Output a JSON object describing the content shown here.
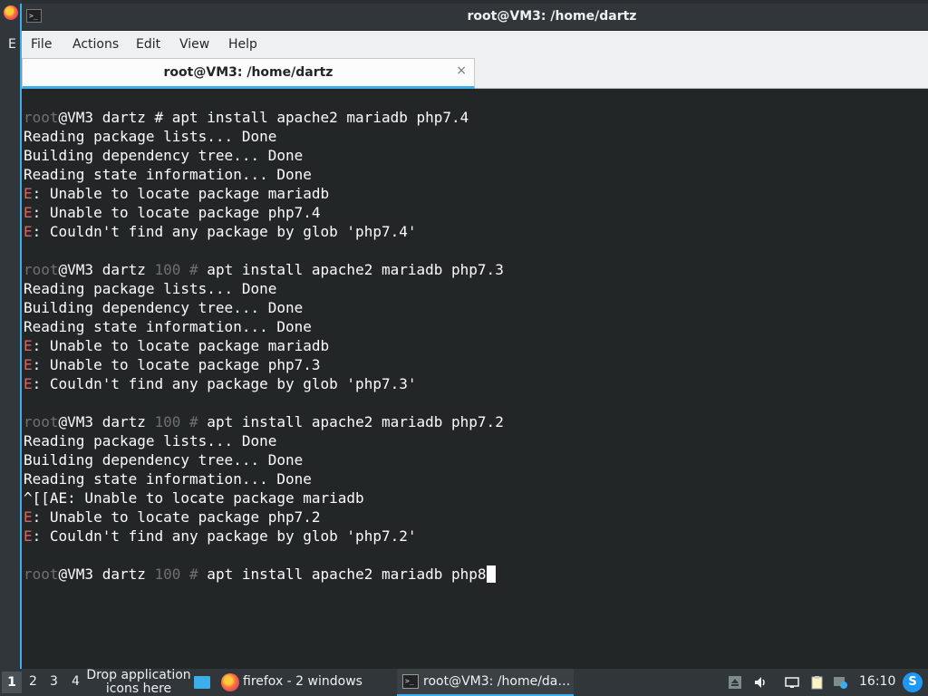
{
  "window": {
    "title": "root@VM3: /home/dartz",
    "menu": [
      "File",
      "Actions",
      "Edit",
      "View",
      "Help"
    ],
    "tab_title": "root@VM3: /home/dartz",
    "tab_close": "×"
  },
  "terminal": {
    "lines": [
      [
        {
          "t": "root",
          "c": "dim"
        },
        {
          "t": "@VM3 dartz # apt install apache2 mariadb php7.4"
        }
      ],
      [
        {
          "t": "Reading package lists... Done"
        }
      ],
      [
        {
          "t": "Building dependency tree... Done"
        }
      ],
      [
        {
          "t": "Reading state information... Done"
        }
      ],
      [
        {
          "t": "E",
          "c": "err"
        },
        {
          "t": ": Unable to locate package mariadb"
        }
      ],
      [
        {
          "t": "E",
          "c": "err"
        },
        {
          "t": ": Unable to locate package php7.4"
        }
      ],
      [
        {
          "t": "E",
          "c": "err"
        },
        {
          "t": ": Couldn't find any package by glob 'php7.4'"
        }
      ],
      [],
      [
        {
          "t": "root",
          "c": "dim"
        },
        {
          "t": "@VM3 dartz "
        },
        {
          "t": "100 #",
          "c": "dim"
        },
        {
          "t": " apt install apache2 mariadb php7.3"
        }
      ],
      [
        {
          "t": "Reading package lists... Done"
        }
      ],
      [
        {
          "t": "Building dependency tree... Done"
        }
      ],
      [
        {
          "t": "Reading state information... Done"
        }
      ],
      [
        {
          "t": "E",
          "c": "err"
        },
        {
          "t": ": Unable to locate package mariadb"
        }
      ],
      [
        {
          "t": "E",
          "c": "err"
        },
        {
          "t": ": Unable to locate package php7.3"
        }
      ],
      [
        {
          "t": "E",
          "c": "err"
        },
        {
          "t": ": Couldn't find any package by glob 'php7.3'"
        }
      ],
      [],
      [
        {
          "t": "root",
          "c": "dim"
        },
        {
          "t": "@VM3 dartz "
        },
        {
          "t": "100 #",
          "c": "dim"
        },
        {
          "t": " apt install apache2 mariadb php7.2"
        }
      ],
      [
        {
          "t": "Reading package lists... Done"
        }
      ],
      [
        {
          "t": "Building dependency tree... Done"
        }
      ],
      [
        {
          "t": "Reading state information... Done"
        }
      ],
      [
        {
          "t": "^[[AE: Unable to locate package mariadb"
        }
      ],
      [
        {
          "t": "E",
          "c": "err"
        },
        {
          "t": ": Unable to locate package php7.2"
        }
      ],
      [
        {
          "t": "E",
          "c": "err"
        },
        {
          "t": ": Couldn't find any package by glob 'php7.2'"
        }
      ],
      [],
      [
        {
          "t": "root",
          "c": "dim"
        },
        {
          "t": "@VM3 dartz "
        },
        {
          "t": "100 #",
          "c": "dim"
        },
        {
          "t": " apt install apache2 mariadb php8"
        },
        {
          "t": "",
          "c": "cursor"
        }
      ]
    ]
  },
  "taskbar": {
    "workspaces": [
      "1",
      "2",
      "3",
      "4"
    ],
    "drop_text": "Drop application icons here",
    "firefox_task": "firefox - 2 windows",
    "terminal_task": "root@VM3: /home/da…",
    "clock": "16:10"
  },
  "desktop": {
    "left_letter": "E"
  }
}
